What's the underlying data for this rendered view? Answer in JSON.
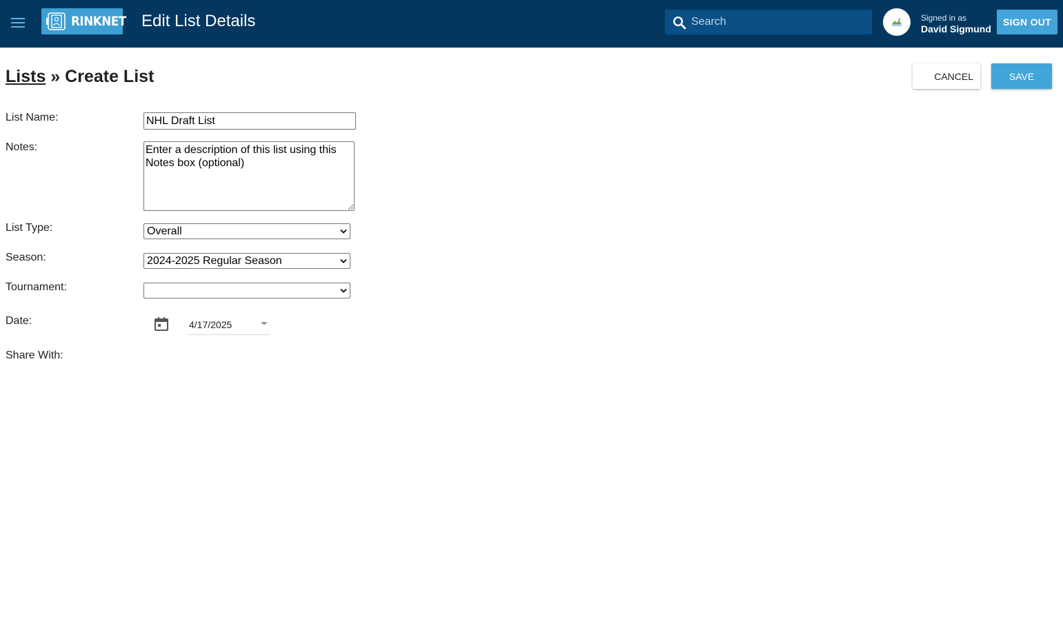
{
  "header": {
    "logo_text": "RINKNET",
    "title": "Edit List Details",
    "search_placeholder": "Search",
    "signed_in_label": "Signed in as",
    "user_name": "David Sigmund",
    "sign_out_label": "SIGN OUT"
  },
  "breadcrumb": {
    "parent": "Lists",
    "separator": " » ",
    "current": "Create List"
  },
  "actions": {
    "cancel_label": "CANCEL",
    "save_label": "SAVE"
  },
  "form": {
    "list_name": {
      "label": "List Name:",
      "value": "NHL Draft List"
    },
    "notes": {
      "label": "Notes:",
      "value": "Enter a description of this list using this Notes box (optional)"
    },
    "list_type": {
      "label": "List Type:",
      "value": "Overall"
    },
    "season": {
      "label": "Season:",
      "value": "2024-2025 Regular Season"
    },
    "tournament": {
      "label": "Tournament:",
      "value": ""
    },
    "date": {
      "label": "Date:",
      "value": "4/17/2025"
    },
    "share_with": {
      "label": "Share With:"
    }
  },
  "icons": {
    "menu": "menu-icon",
    "search": "search-icon",
    "calendar": "calendar-icon",
    "dropdown": "chevron-down-icon"
  },
  "colors": {
    "appbar": "#03375f",
    "accent": "#42a4d8",
    "search_bg": "#0a4f86"
  }
}
